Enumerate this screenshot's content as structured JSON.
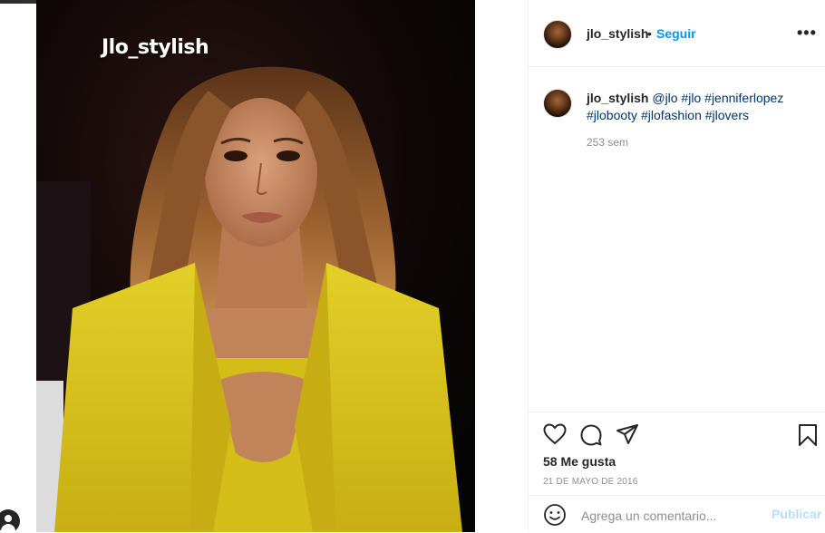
{
  "photo": {
    "caption_overlay": "Jlo_stylish",
    "colors": {
      "coat": "#d8c21a",
      "background": "#0b0606",
      "hair": "#7a4a22"
    }
  },
  "header": {
    "username": "jlo_stylish",
    "separator": "•",
    "follow_label": "Seguir",
    "more_label": "•••"
  },
  "caption": {
    "username": "jlo_stylish",
    "mention": "@jlo",
    "hashtags": [
      "#jlo",
      "#jenniferlopez",
      "#jlobooty",
      "#jlofashion",
      "#jlovers"
    ],
    "time": "253 sem"
  },
  "actions": {
    "icons": [
      "heart-icon",
      "comment-icon",
      "share-icon",
      "bookmark-icon"
    ],
    "likes": "58 Me gusta",
    "date": "21 DE MAYO DE 2016"
  },
  "comment": {
    "placeholder": "Agrega un comentario...",
    "post_label": "Publicar",
    "emoji_icon": "emoji-icon"
  },
  "colors": {
    "accent": "#0095f6",
    "hashtag": "#00376b",
    "muted": "#8e8e8e",
    "post_disabled": "#b2dffc"
  }
}
